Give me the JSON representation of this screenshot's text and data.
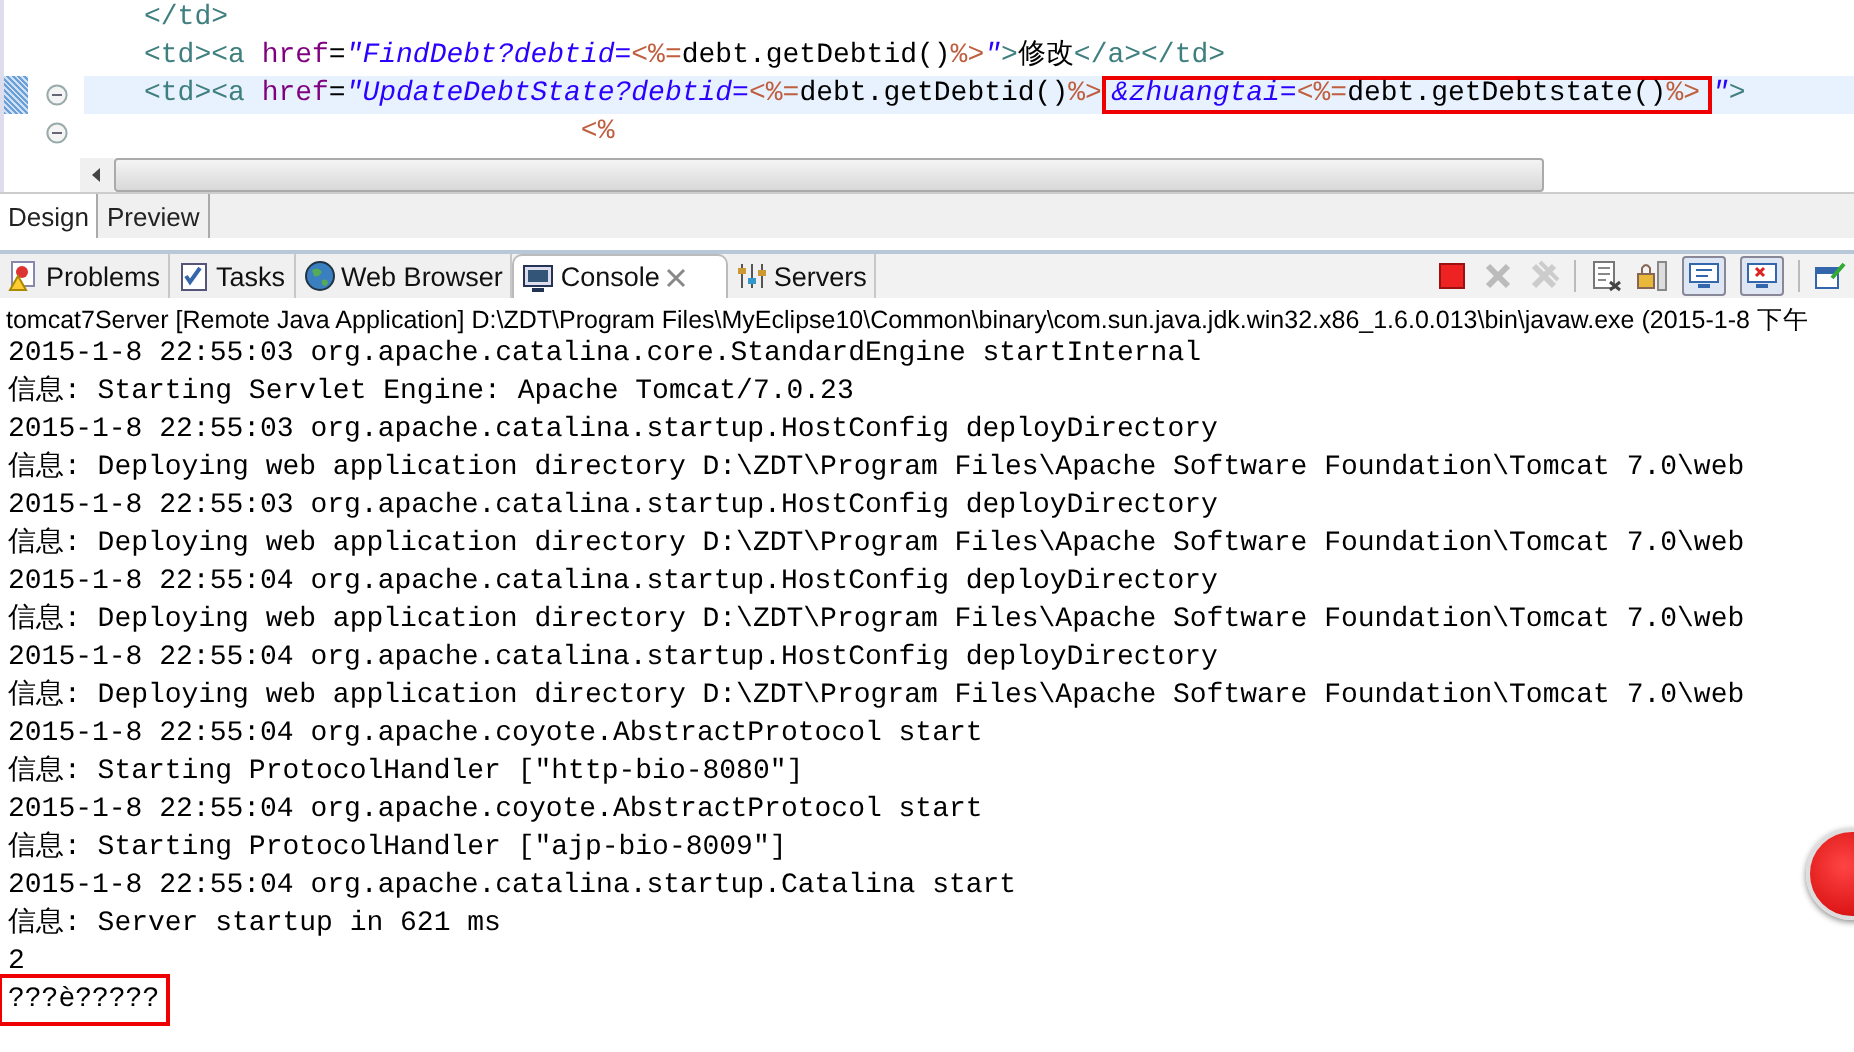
{
  "editor": {
    "lines": [
      {
        "fold_marker": false,
        "current": false,
        "segments": [
          {
            "boxed": false,
            "tokens": [
              {
                "kind": "tag",
                "text": "</td>"
              }
            ]
          }
        ]
      },
      {
        "fold_marker": false,
        "current": false,
        "segments": [
          {
            "boxed": false,
            "tokens": [
              {
                "kind": "tag",
                "text": "<td><a "
              },
              {
                "kind": "attr",
                "text": "href"
              },
              {
                "kind": "plain",
                "text": "="
              },
              {
                "kind": "string",
                "text": "\"FindDebt?debtid="
              },
              {
                "kind": "jsp",
                "text": "<%="
              },
              {
                "kind": "plain",
                "text": "debt.getDebtid()"
              },
              {
                "kind": "jsp",
                "text": "%>"
              },
              {
                "kind": "string",
                "text": "\""
              },
              {
                "kind": "tag",
                "text": ">"
              },
              {
                "kind": "plain",
                "text": "修改"
              },
              {
                "kind": "tag",
                "text": "</a></td>"
              }
            ]
          }
        ]
      },
      {
        "fold_marker": true,
        "current": true,
        "segments": [
          {
            "boxed": false,
            "tokens": [
              {
                "kind": "tag",
                "text": "<td><a "
              },
              {
                "kind": "attr",
                "text": "href"
              },
              {
                "kind": "plain",
                "text": "="
              },
              {
                "kind": "string",
                "text": "\"UpdateDebtState?debtid="
              },
              {
                "kind": "jsp",
                "text": "<%="
              },
              {
                "kind": "plain",
                "text": "debt.getDebtid()"
              },
              {
                "kind": "jsp",
                "text": "%>"
              }
            ]
          },
          {
            "boxed": true,
            "tokens": [
              {
                "kind": "string",
                "text": "&zhuangtai="
              },
              {
                "kind": "jsp",
                "text": "<%="
              },
              {
                "kind": "plain",
                "text": "debt.getDebtstate()"
              },
              {
                "kind": "jsp",
                "text": "%>"
              }
            ]
          },
          {
            "boxed": false,
            "tokens": [
              {
                "kind": "string",
                "text": "\""
              },
              {
                "kind": "tag",
                "text": ">"
              }
            ]
          }
        ]
      },
      {
        "fold_marker": true,
        "current": false,
        "segments": [
          {
            "boxed": false,
            "tokens": [
              {
                "kind": "jsp",
                "text": "                          <%"
              }
            ]
          }
        ]
      }
    ]
  },
  "editor_tabs": [
    {
      "label": "Design",
      "selected": true
    },
    {
      "label": "Preview",
      "selected": false
    }
  ],
  "view_tabs": [
    {
      "label": "Problems",
      "selected": false
    },
    {
      "label": "Tasks",
      "selected": false
    },
    {
      "label": "Web Browser",
      "selected": false
    },
    {
      "label": "Console",
      "selected": true
    },
    {
      "label": "Servers",
      "selected": false
    }
  ],
  "console": {
    "header": "tomcat7Server [Remote Java Application] D:\\ZDT\\Program Files\\MyEclipse10\\Common\\binary\\com.sun.java.jdk.win32.x86_1.6.0.013\\bin\\javaw.exe (2015-1-8 下午",
    "lines": [
      {
        "text": "2015-1-8 22:55:03 org.apache.catalina.core.StandardEngine startInternal",
        "boxed": false
      },
      {
        "text": "信息: Starting Servlet Engine: Apache Tomcat/7.0.23",
        "boxed": false
      },
      {
        "text": "2015-1-8 22:55:03 org.apache.catalina.startup.HostConfig deployDirectory",
        "boxed": false
      },
      {
        "text": "信息: Deploying web application directory D:\\ZDT\\Program Files\\Apache Software Foundation\\Tomcat 7.0\\web",
        "boxed": false
      },
      {
        "text": "2015-1-8 22:55:03 org.apache.catalina.startup.HostConfig deployDirectory",
        "boxed": false
      },
      {
        "text": "信息: Deploying web application directory D:\\ZDT\\Program Files\\Apache Software Foundation\\Tomcat 7.0\\web",
        "boxed": false
      },
      {
        "text": "2015-1-8 22:55:04 org.apache.catalina.startup.HostConfig deployDirectory",
        "boxed": false
      },
      {
        "text": "信息: Deploying web application directory D:\\ZDT\\Program Files\\Apache Software Foundation\\Tomcat 7.0\\web",
        "boxed": false
      },
      {
        "text": "2015-1-8 22:55:04 org.apache.catalina.startup.HostConfig deployDirectory",
        "boxed": false
      },
      {
        "text": "信息: Deploying web application directory D:\\ZDT\\Program Files\\Apache Software Foundation\\Tomcat 7.0\\web",
        "boxed": false
      },
      {
        "text": "2015-1-8 22:55:04 org.apache.coyote.AbstractProtocol start",
        "boxed": false
      },
      {
        "text": "信息: Starting ProtocolHandler [\"http-bio-8080\"]",
        "boxed": false
      },
      {
        "text": "2015-1-8 22:55:04 org.apache.coyote.AbstractProtocol start",
        "boxed": false
      },
      {
        "text": "信息: Starting ProtocolHandler [\"ajp-bio-8009\"]",
        "boxed": false
      },
      {
        "text": "2015-1-8 22:55:04 org.apache.catalina.startup.Catalina start",
        "boxed": false
      },
      {
        "text": "信息: Server startup in 621 ms",
        "boxed": false
      },
      {
        "text": "2",
        "boxed": false
      },
      {
        "text": "???è?????",
        "boxed": true
      }
    ]
  }
}
